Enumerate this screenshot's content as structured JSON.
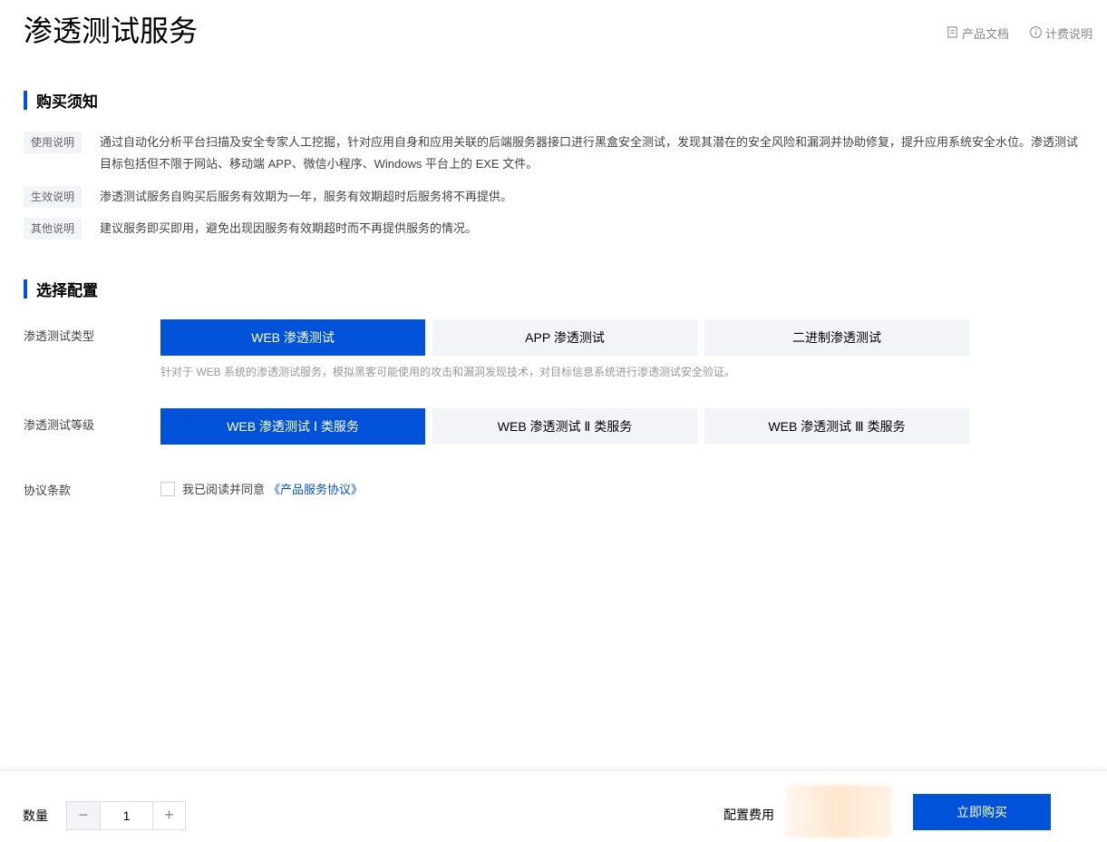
{
  "page": {
    "title": "渗透测试服务"
  },
  "top_links": [
    {
      "label": "产品文档",
      "icon": "document-icon"
    },
    {
      "label": "计费说明",
      "icon": "info-icon"
    }
  ],
  "notice": {
    "heading": "购买须知",
    "rows": [
      {
        "tag": "使用说明",
        "text": "通过自动化分析平台扫描及安全专家人工挖掘，针对应用自身和应用关联的后端服务器接口进行黑盒安全测试，发现其潜在的安全风险和漏洞并协助修复，提升应用系统安全水位。渗透测试目标包括但不限于网站、移动端 APP、微信小程序、Windows 平台上的 EXE 文件。"
      },
      {
        "tag": "生效说明",
        "text": "渗透测试服务自购买后服务有效期为一年，服务有效期超时后服务将不再提供。"
      },
      {
        "tag": "其他说明",
        "text": "建议服务即买即用，避免出现因服务有效期超时而不再提供服务的情况。"
      }
    ]
  },
  "config": {
    "heading": "选择配置",
    "type": {
      "label": "渗透测试类型",
      "options": [
        "WEB 渗透测试",
        "APP 渗透测试",
        "二进制渗透测试"
      ],
      "selected": "WEB 渗透测试",
      "hint": "针对于 WEB 系统的渗透测试服务，模拟黑客可能使用的攻击和漏洞发现技术，对目标信息系统进行渗透测试安全验证。"
    },
    "level": {
      "label": "渗透测试等级",
      "options": [
        "WEB 渗透测试 Ⅰ 类服务",
        "WEB 渗透测试 Ⅱ 类服务",
        "WEB 渗透测试 Ⅲ 类服务"
      ],
      "selected": "WEB 渗透测试 Ⅰ 类服务"
    },
    "agreement": {
      "label": "协议条款",
      "text": "我已阅读并同意",
      "link": "《产品服务协议》",
      "checked": false
    }
  },
  "footer": {
    "qty_label": "数量",
    "qty_value": "1",
    "minus": "−",
    "plus": "+",
    "fee_label": "配置费用",
    "buy_label": "立即购买"
  },
  "colors": {
    "accent": "#0052d9",
    "price": "#ff7a00"
  }
}
